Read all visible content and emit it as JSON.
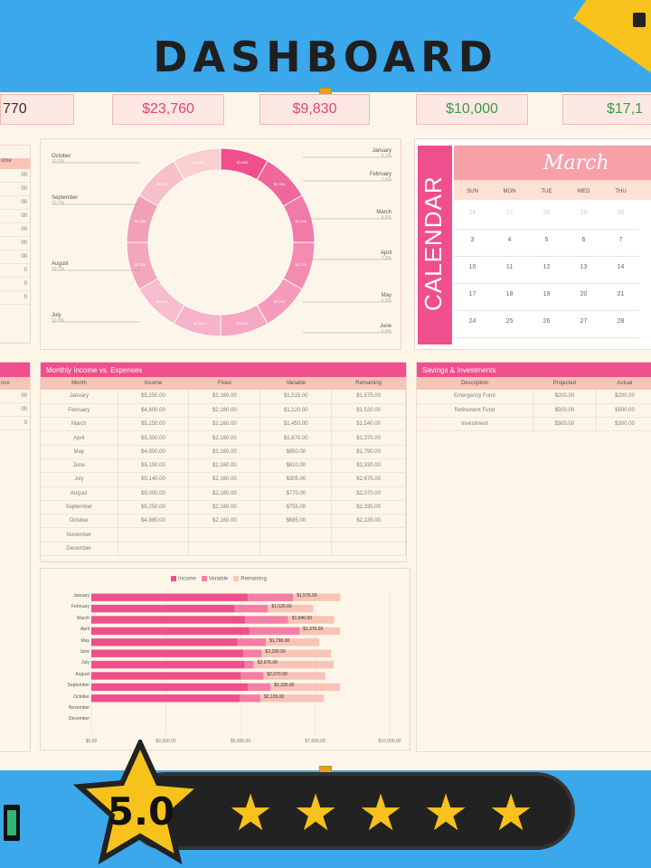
{
  "header": {
    "title": "DASHBOARD"
  },
  "kpis": [
    {
      "value": "770",
      "tone": "dark"
    },
    {
      "value": "$23,760",
      "tone": "red"
    },
    {
      "value": "$9,830",
      "tone": "red"
    },
    {
      "value": "$10,000",
      "tone": "green"
    },
    {
      "value": "$17,1",
      "tone": "green"
    }
  ],
  "colors": {
    "brand_pink": "#ef4f8d",
    "light_pink": "#f8c4b6",
    "cream": "#fdf6e8",
    "sky": "#3aa8ea",
    "gold": "#f7c21b"
  },
  "left_strip": {
    "header": "ome",
    "rows": [
      "00",
      "00",
      "00",
      "00",
      "00",
      "00",
      "00",
      "0",
      "0",
      "0"
    ],
    "header2": "nce",
    "rows2": [
      "00",
      "00",
      "0"
    ]
  },
  "donut": {
    "labels_left": [
      {
        "name": "October",
        "pct": "10.0%"
      },
      {
        "name": "September",
        "pct": "10.7%"
      },
      {
        "name": "August",
        "pct": "10.7%"
      },
      {
        "name": "July",
        "pct": "10.9%"
      }
    ],
    "labels_right": [
      {
        "name": "January",
        "pct": "5.1%"
      },
      {
        "name": "February",
        "pct": "7.6%"
      },
      {
        "name": "March",
        "pct": "8.0%"
      },
      {
        "name": "April",
        "pct": "7.3%"
      },
      {
        "name": "May",
        "pct": "6.2%"
      },
      {
        "name": "June",
        "pct": "6.0%"
      }
    ],
    "slice_values": [
      "$3,880",
      "$2,960",
      "$1,548",
      "$1,376",
      "$2,045",
      "$1,540",
      "$2,610",
      "$2,870",
      "$2,530",
      "$2,380",
      "$3,045",
      "$3,0605"
    ]
  },
  "calendar": {
    "side_label": "CALENDAR",
    "month": "March",
    "dow": [
      "SUN",
      "MON",
      "TUE",
      "WED",
      "THU"
    ],
    "weeks": [
      [
        "26",
        "27",
        "28",
        "29",
        "30"
      ],
      [
        "3",
        "4",
        "5",
        "6",
        "7"
      ],
      [
        "10",
        "11",
        "12",
        "13",
        "14"
      ],
      [
        "17",
        "18",
        "19",
        "20",
        "21"
      ],
      [
        "24",
        "25",
        "26",
        "27",
        "28"
      ]
    ]
  },
  "monthly": {
    "title": "Monthly Income vs. Expenses",
    "columns": [
      "Month",
      "Income",
      "Fixed",
      "Variable",
      "Remaining"
    ],
    "rows": [
      [
        "January",
        "$5,250.00",
        "$2,160.00",
        "$1,515.00",
        "$1,575.00"
      ],
      [
        "February",
        "$4,800.00",
        "$2,160.00",
        "$1,120.00",
        "$1,520.00"
      ],
      [
        "March",
        "$5,150.00",
        "$2,160.00",
        "$1,450.00",
        "$1,540.00"
      ],
      [
        "April",
        "$5,300.00",
        "$2,160.00",
        "$1,670.00",
        "$1,370.00"
      ],
      [
        "May",
        "$4,900.00",
        "$2,160.00",
        "$950.00",
        "$1,790.00"
      ],
      [
        "June",
        "$5,100.00",
        "$2,160.00",
        "$610.00",
        "$2,330.00"
      ],
      [
        "July",
        "$5,140.00",
        "$2,160.00",
        "$305.00",
        "$2,675.00"
      ],
      [
        "August",
        "$5,000.00",
        "$2,160.00",
        "$770.00",
        "$2,070.00"
      ],
      [
        "September",
        "$5,250.00",
        "$2,160.00",
        "$755.00",
        "$2,335.00"
      ],
      [
        "October",
        "$4,980.00",
        "$2,160.00",
        "$685.00",
        "$2,135.00"
      ],
      [
        "November",
        "",
        "",
        "",
        ""
      ],
      [
        "December",
        "",
        "",
        "",
        ""
      ]
    ]
  },
  "savings": {
    "title": "Savings & Investments",
    "columns": [
      "Description",
      "Projected",
      "Actual"
    ],
    "rows": [
      [
        "Emergency Fund",
        "$200.00",
        "$200.00"
      ],
      [
        "Retirement Fund",
        "$500.00",
        "$500.00"
      ],
      [
        "Investment",
        "$300.00",
        "$300.00"
      ]
    ]
  },
  "bar_chart": {
    "legend": [
      "Income",
      "Variable",
      "Remaining"
    ],
    "x_ticks": [
      "$0.00",
      "$2,500.00",
      "$5,000.00",
      "$7,500.00",
      "$10,000.00"
    ],
    "row_labels": [
      "January",
      "February",
      "March",
      "April",
      "May",
      "June",
      "July",
      "August",
      "September",
      "October",
      "November",
      "December"
    ],
    "value_labels": [
      "$1,575.00",
      "$1,520.00",
      "$1,540.00",
      "$1,370.00",
      "$1,790.00",
      "$2,330.00",
      "$2,675.00",
      "$2,070.00",
      "$2,335.00",
      "$2,135.00",
      "",
      ""
    ]
  },
  "chart_data": {
    "type": "bar",
    "categories": [
      "January",
      "February",
      "March",
      "April",
      "May",
      "June",
      "July",
      "August",
      "September",
      "October",
      "November",
      "December"
    ],
    "series": [
      {
        "name": "Income",
        "values": [
          5250,
          4800,
          5150,
          5300,
          4900,
          5100,
          5140,
          5000,
          5250,
          4980,
          0,
          0
        ]
      },
      {
        "name": "Variable",
        "values": [
          1515,
          1120,
          1450,
          1670,
          950,
          610,
          305,
          770,
          755,
          685,
          0,
          0
        ]
      },
      {
        "name": "Remaining",
        "values": [
          1575,
          1520,
          1540,
          1370,
          1790,
          2330,
          2675,
          2070,
          2335,
          2135,
          0,
          0
        ]
      }
    ],
    "xlim": [
      0,
      10000
    ],
    "orientation": "horizontal",
    "stacked": true,
    "legend": "top-center"
  },
  "rating": {
    "score": "5.0",
    "stars": 5
  }
}
